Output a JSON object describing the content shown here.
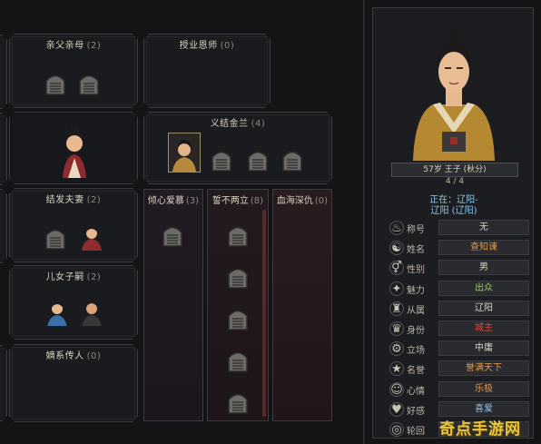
{
  "panels": {
    "parents": {
      "title": "亲父亲母",
      "count": "(2)"
    },
    "master": {
      "title": "授业恩师",
      "count": "(0)"
    },
    "sworn": {
      "title": "义结金兰",
      "count": "(4)"
    },
    "spouse": {
      "title": "结发夫妻",
      "count": "(2)"
    },
    "children": {
      "title": "儿女子嗣",
      "count": "(2)"
    },
    "heir": {
      "title": "嫡系传人",
      "count": "(0)"
    }
  },
  "columns": {
    "love": {
      "title": "倾心爱慕",
      "count": "(3)"
    },
    "enemy": {
      "title": "誓不两立",
      "count": "(8)"
    },
    "feud": {
      "title": "血海深仇",
      "count": "(0)"
    }
  },
  "character": {
    "age_name": "57岁 王子 (秋分)",
    "slash": "4 / 4",
    "location_line1": "正在：辽阳-",
    "location_line2": "辽阳 (辽阳)",
    "attributes": [
      {
        "icon": "title-icon",
        "label": "称号",
        "value": "无",
        "color": "#d8d2c4"
      },
      {
        "icon": "surname-icon",
        "label": "姓名",
        "value": "查知谏",
        "color": "#e39a4f"
      },
      {
        "icon": "gender-icon",
        "label": "性别",
        "value": "男",
        "color": "#d8d2c4"
      },
      {
        "icon": "charm-icon",
        "label": "魅力",
        "value": "出众",
        "color": "#9ccf63"
      },
      {
        "icon": "faction-icon",
        "label": "从属",
        "value": "辽阳",
        "color": "#d8d2c4"
      },
      {
        "icon": "identity-icon",
        "label": "身份",
        "value": "城主",
        "color": "#e2463a"
      },
      {
        "icon": "stance-icon",
        "label": "立场",
        "value": "中庸",
        "color": "#d8d2c4"
      },
      {
        "icon": "fame-icon",
        "label": "名誉",
        "value": "誉满天下",
        "color": "#e39a4f"
      },
      {
        "icon": "mood-icon",
        "label": "心情",
        "value": "乐极",
        "color": "#e39a4f"
      },
      {
        "icon": "preference-icon",
        "label": "好感",
        "value": "喜爱",
        "color": "#8cc4e8"
      },
      {
        "icon": "samsara-icon",
        "label": "轮回",
        "value": "",
        "color": "#d8d2c4"
      }
    ]
  },
  "watermark": "奇点手游网"
}
